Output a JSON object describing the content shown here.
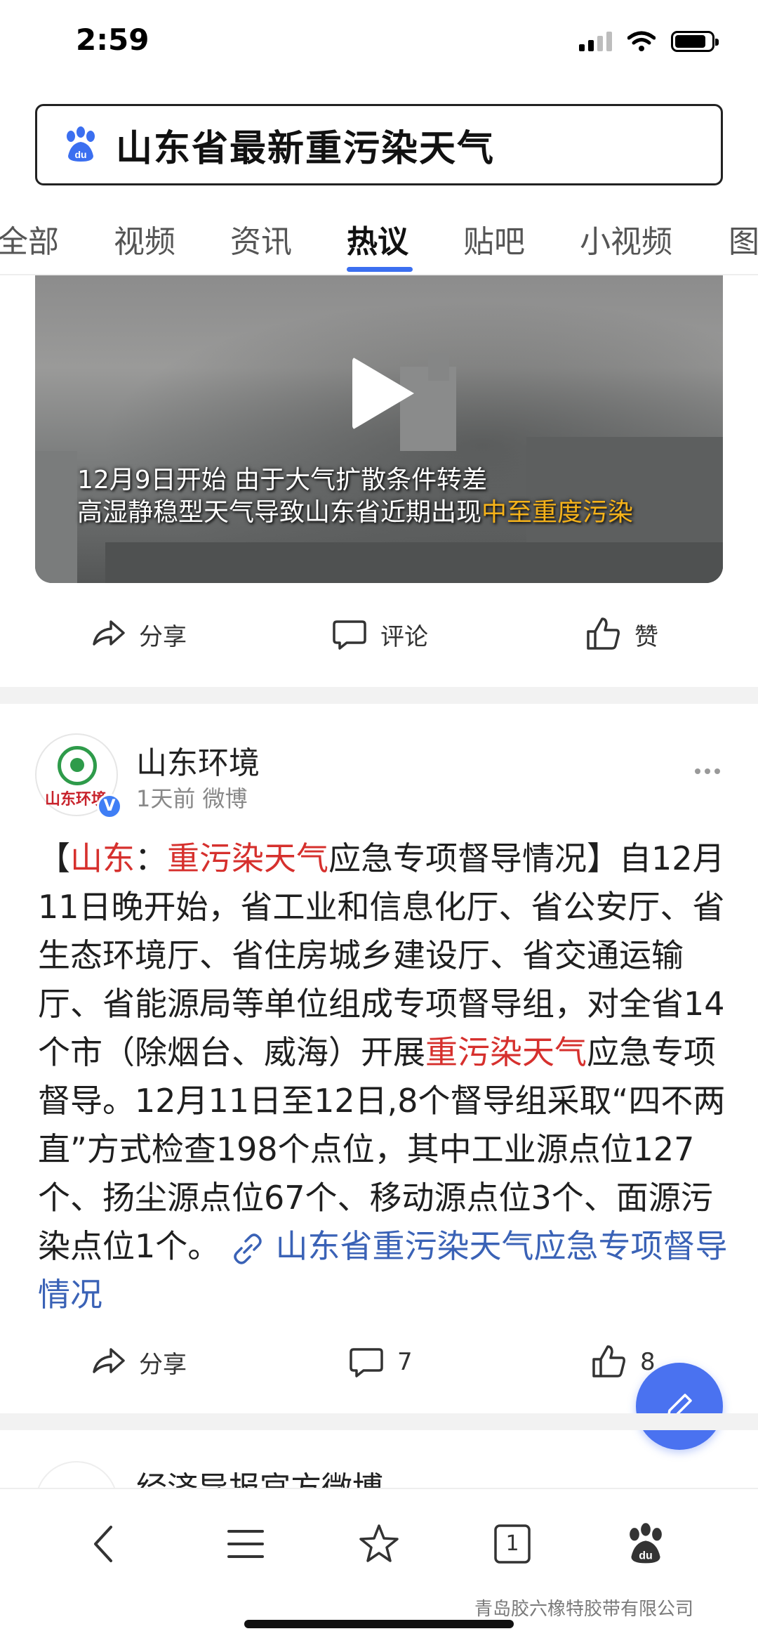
{
  "status_bar": {
    "time": "2:59"
  },
  "search": {
    "query": "山东省最新重污染天气"
  },
  "tabs": [
    {
      "label": "全部"
    },
    {
      "label": "视频"
    },
    {
      "label": "资讯"
    },
    {
      "label": "热议",
      "active": true
    },
    {
      "label": "贴吧"
    },
    {
      "label": "小视频"
    },
    {
      "label": "图"
    }
  ],
  "video": {
    "caption_line1": "12月9日开始 由于大气扩散条件转差",
    "caption_line2_plain": "高湿静稳型天气导致山东省近期出现",
    "caption_line2_highlight": "中至重度污染"
  },
  "video_actions": {
    "share": "分享",
    "comment": "评论",
    "like": "赞"
  },
  "post": {
    "author": "山东环境",
    "meta": "1天前 微博",
    "avatar_text": "山东环境",
    "verified_mark": "V",
    "body": {
      "bracket_open": "【",
      "tag1": "山东",
      "colon": "：",
      "tag2": "重污染天气",
      "title_rest": "应急专项督导情况】自12月11日晚开始，省工业和信息化厅、省公安厅、省生态环境厅、省住房城乡建设厅、省交通运输厅、省能源局等单位组成专项督导组，对全省14个市（除烟台、威海）开展",
      "tag3": "重污染天气",
      "rest": "应急专项督导。12月11日至12日,8个督导组采取“四不两直”方式检查198个点位，其中工业源点位127个、扬尘源点位67个、移动源点位3个、面源污染点位1个。",
      "link_text": "山东省重污染天气应急专项督导情况"
    },
    "actions": {
      "share": "分享",
      "comment_count": "7",
      "like_count": "8"
    }
  },
  "next_post": {
    "title": "经济导报官方微博"
  },
  "bottom_nav": {
    "tab_count": "1"
  },
  "watermark": "青岛胶六橡特胶带有限公司",
  "colors": {
    "accent": "#3b6ff0",
    "highlight_red": "#d6302d",
    "link_blue": "#3a62b6",
    "fab": "#4a72f0"
  }
}
